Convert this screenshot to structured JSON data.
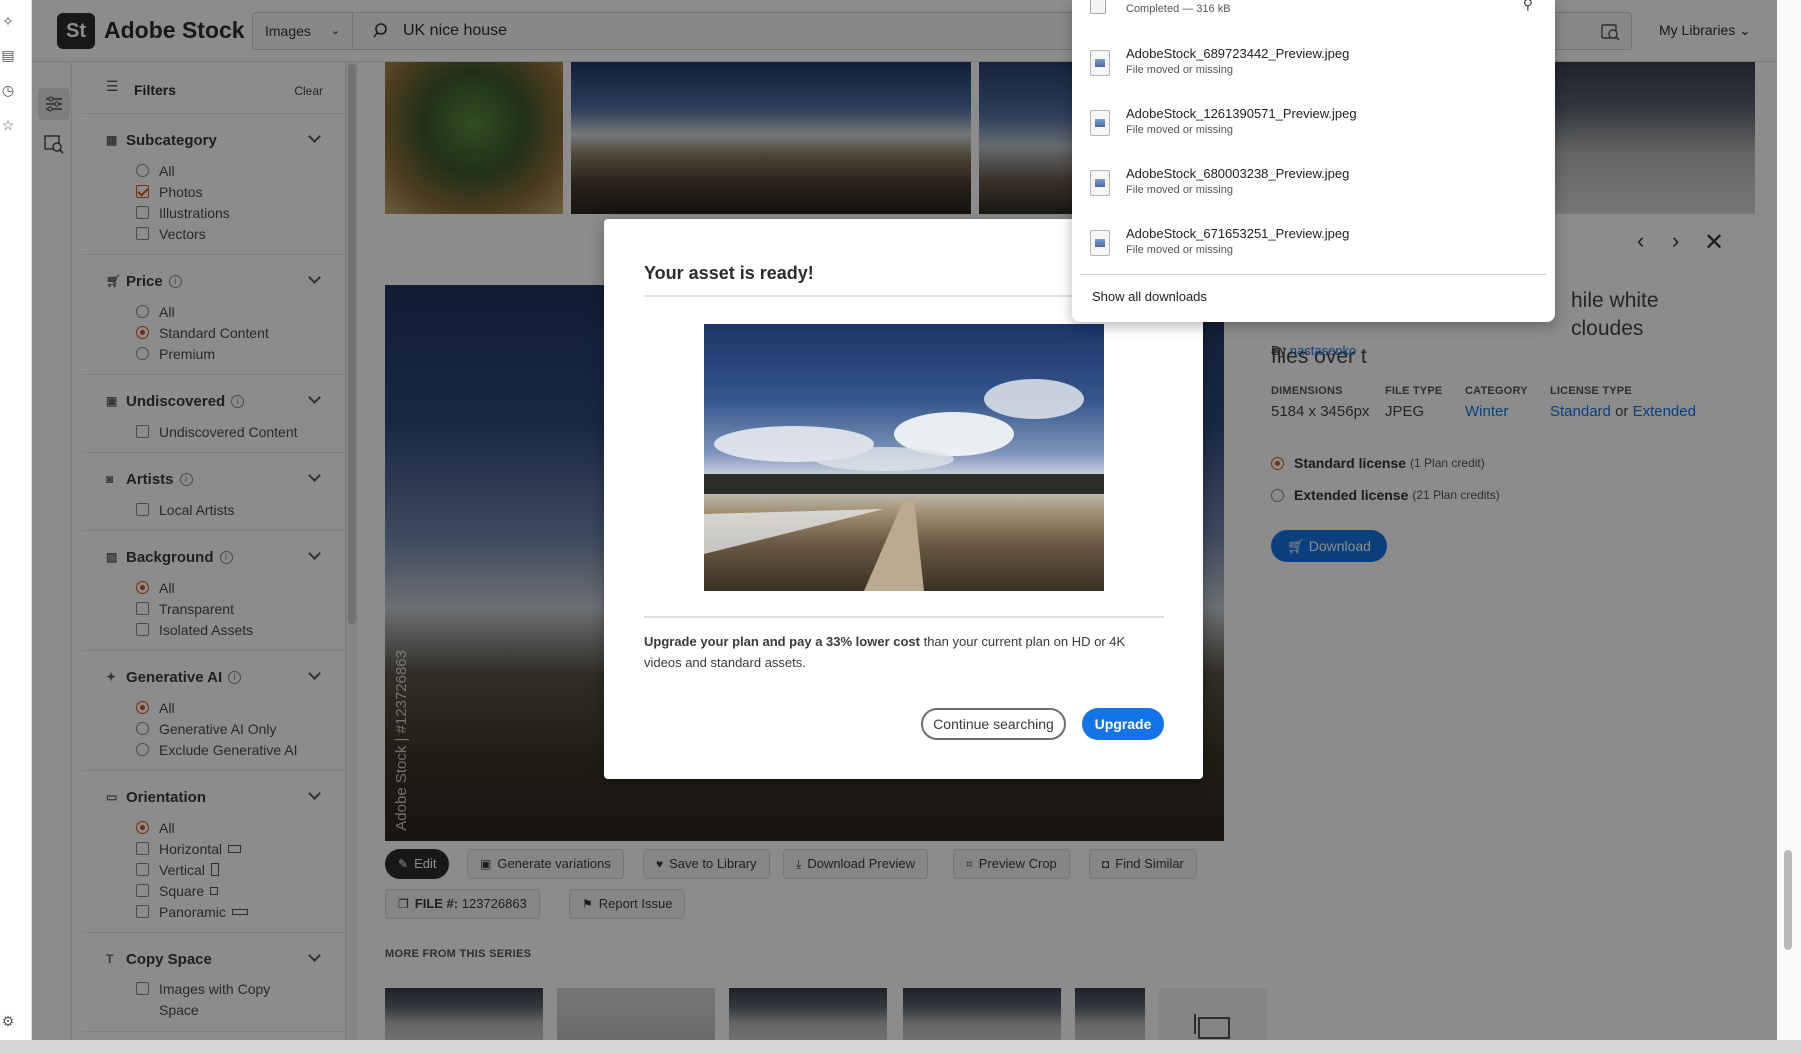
{
  "header": {
    "brand_initials": "St",
    "brand_name": "Adobe Stock",
    "search_type": "Images",
    "search_value": "UK nice house",
    "my_libraries": "My Libraries"
  },
  "filters": {
    "title": "Filters",
    "clear": "Clear",
    "subcategory": {
      "title": "Subcategory",
      "options": [
        "All",
        "Photos",
        "Illustrations",
        "Vectors"
      ]
    },
    "price": {
      "title": "Price",
      "options": [
        "All",
        "Standard Content",
        "Premium"
      ]
    },
    "undiscovered": {
      "title": "Undiscovered",
      "options": [
        "Undiscovered Content"
      ]
    },
    "artists": {
      "title": "Artists",
      "options": [
        "Local Artists"
      ]
    },
    "background": {
      "title": "Background",
      "options": [
        "All",
        "Transparent",
        "Isolated Assets"
      ]
    },
    "generative_ai": {
      "title": "Generative AI",
      "options": [
        "All",
        "Generative AI Only",
        "Exclude Generative AI"
      ]
    },
    "orientation": {
      "title": "Orientation",
      "options": [
        "All",
        "Horizontal",
        "Vertical",
        "Square",
        "Panoramic"
      ]
    },
    "copy_space": {
      "title": "Copy Space",
      "options": [
        "Images with Copy Space"
      ]
    }
  },
  "main": {
    "watermark": "Adobe Stock | #123726863",
    "actions": {
      "edit": "Edit",
      "generate_variations": "Generate variations",
      "save_to_library": "Save to Library",
      "download_preview": "Download Preview",
      "preview_crop": "Preview Crop",
      "find_similar": "Find Similar",
      "file_label": "FILE #:",
      "file_number": "123726863",
      "report_issue": "Report Issue"
    },
    "series_title": "MORE FROM THIS SERIES"
  },
  "detail": {
    "title_line1": "hile white cloudes",
    "title_line2": "flies over t",
    "by": "By",
    "author": "nastasenko",
    "dimensions_label": "DIMENSIONS",
    "dimensions_value": "5184 x 3456px",
    "filetype_label": "FILE TYPE",
    "filetype_value": "JPEG",
    "category_label": "CATEGORY",
    "category_value": "Winter",
    "license_label": "LICENSE TYPE",
    "license_standard": "Standard",
    "license_or": "or",
    "license_extended": "Extended",
    "standard_license": "Standard license",
    "standard_credits": "(1 Plan credit)",
    "extended_license": "Extended license",
    "extended_credits": "(21 Plan credits)",
    "download": "Download"
  },
  "modal": {
    "title": "Your asset is ready!",
    "text_bold": "Upgrade your plan and pay a 33% lower cost",
    "text_rest": "than your current plan on HD or 4K videos and standard assets.",
    "continue_searching": "Continue searching",
    "upgrade": "Upgrade"
  },
  "downloads": {
    "top_status": "Completed — 316 kB",
    "items": [
      {
        "name": "AdobeStock_689723442_Preview.jpeg",
        "status": "File moved or missing"
      },
      {
        "name": "AdobeStock_1261390571_Preview.jpeg",
        "status": "File moved or missing"
      },
      {
        "name": "AdobeStock_680003238_Preview.jpeg",
        "status": "File moved or missing"
      },
      {
        "name": "AdobeStock_671653251_Preview.jpeg",
        "status": "File moved or missing"
      }
    ],
    "show_all": "Show all downloads"
  },
  "colors": {
    "accent": "#1473e6",
    "filter_selected": "#d4571e",
    "overlay": "rgba(0,0,0,0.45)"
  }
}
